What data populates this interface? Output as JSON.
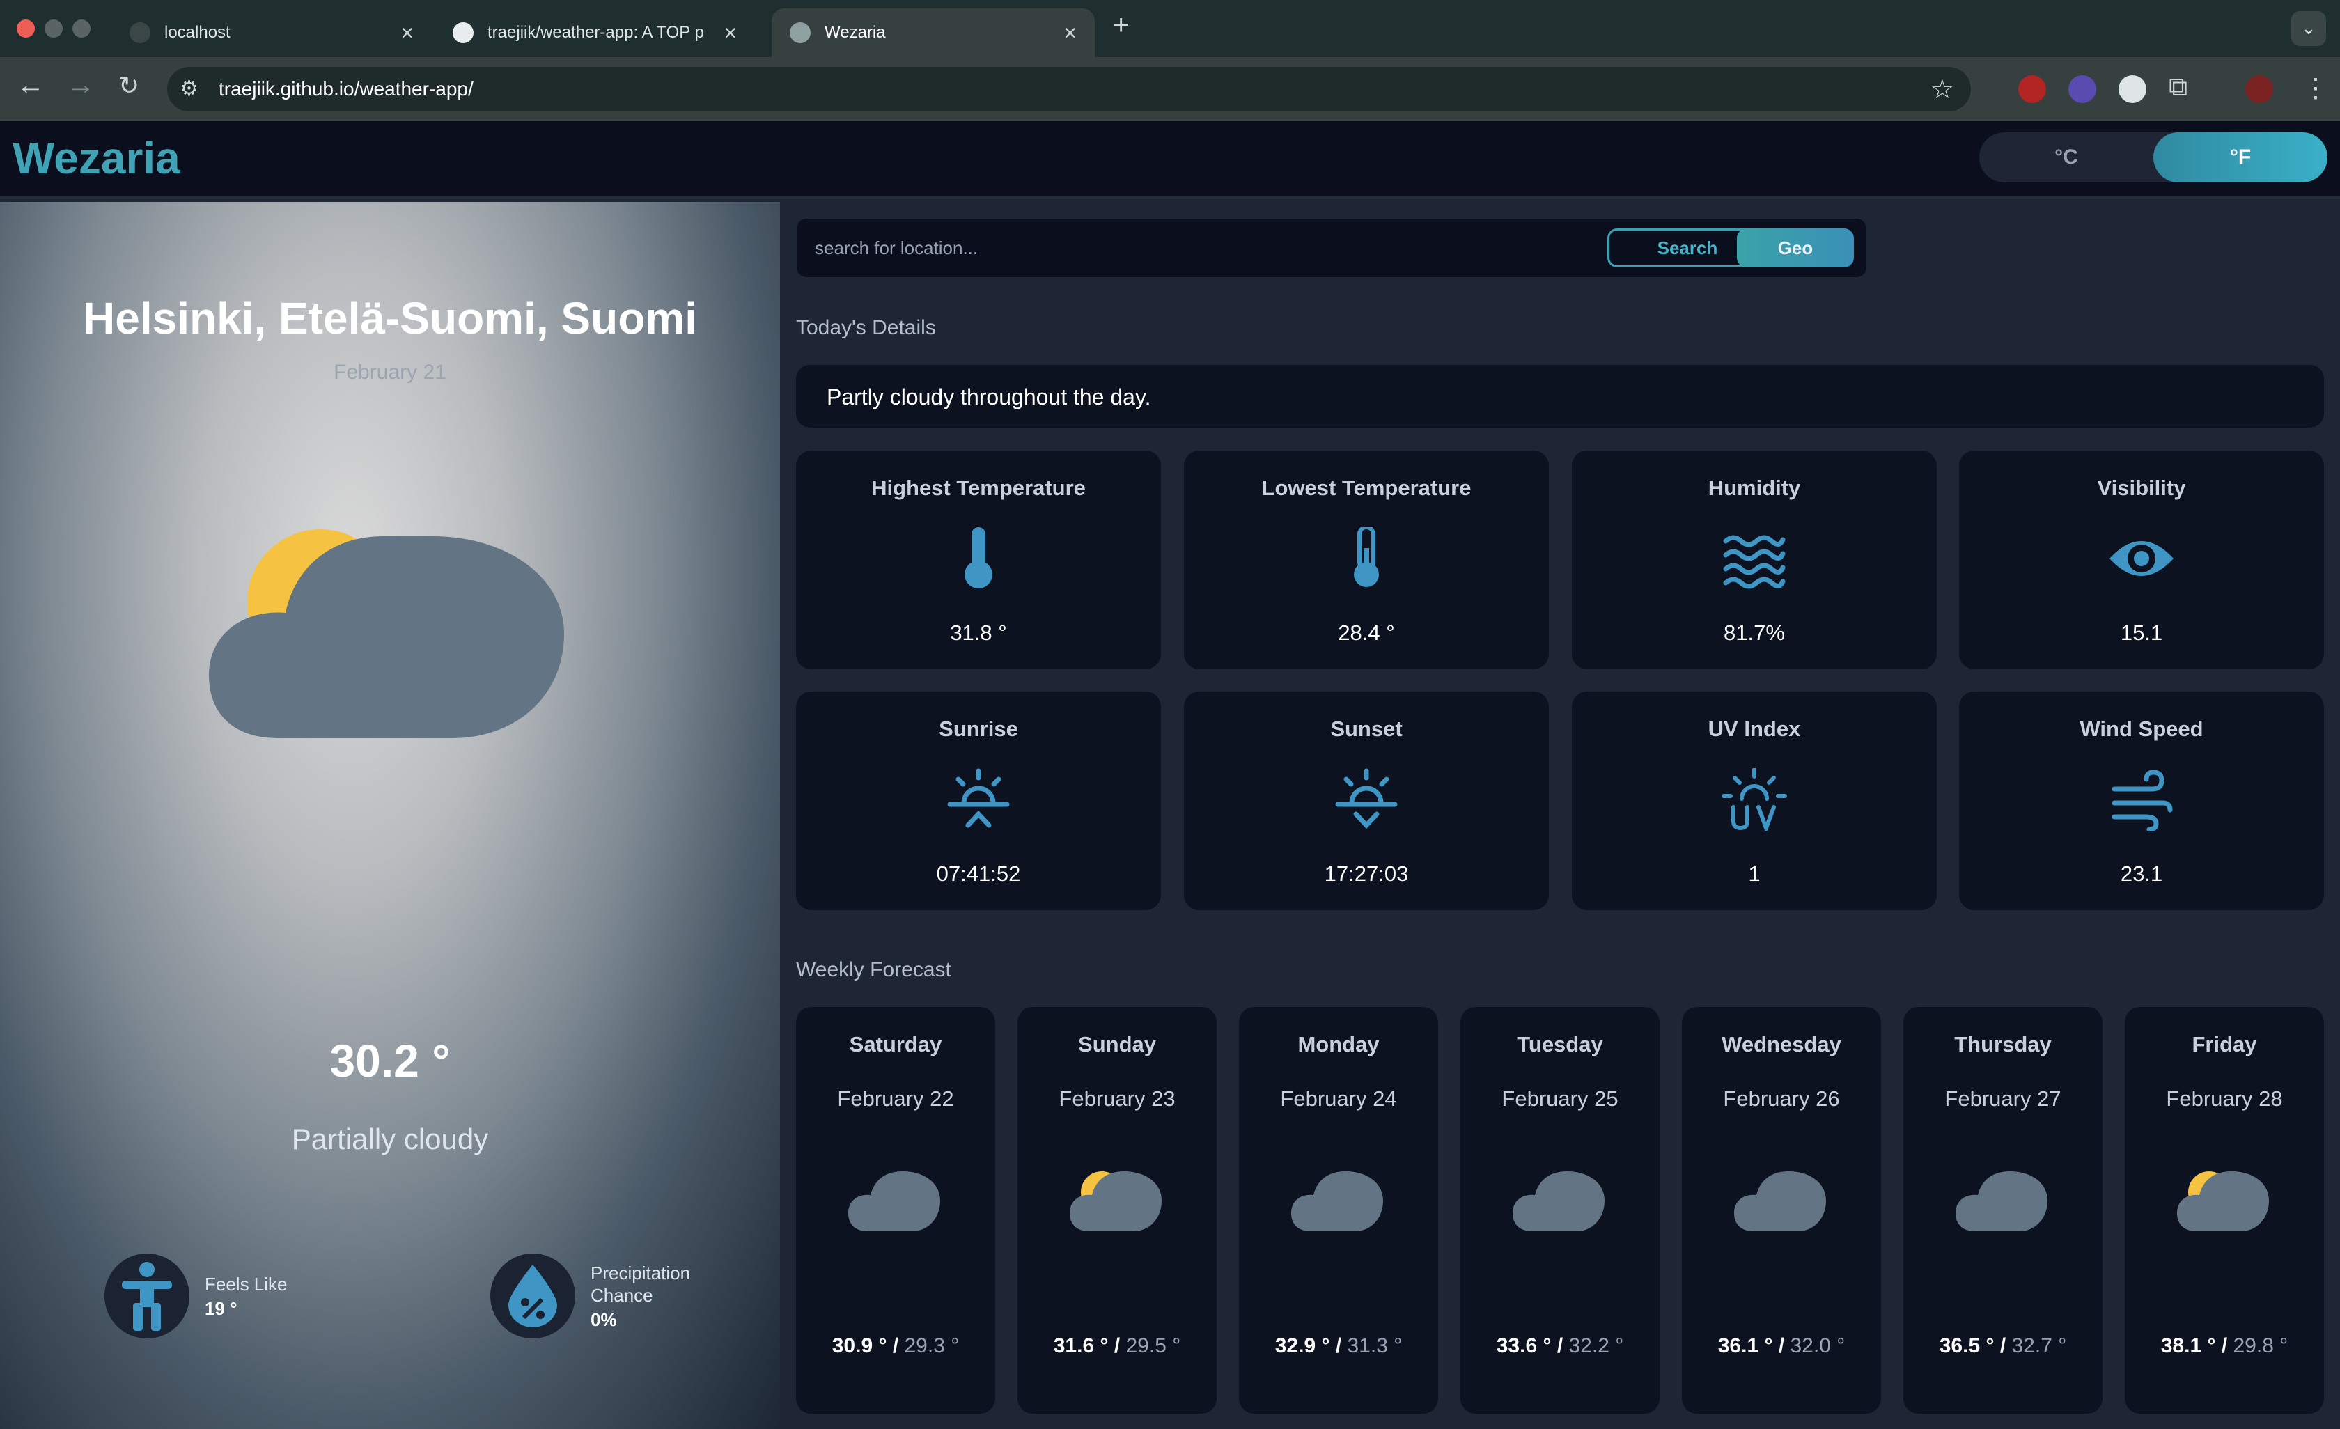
{
  "browser": {
    "tabs": [
      {
        "title": "localhost"
      },
      {
        "title": "traejiik/weather-app: A TOP p"
      },
      {
        "title": "Wezaria"
      }
    ],
    "url": "traejiik.github.io/weather-app/"
  },
  "app": {
    "logo": "Wezaria",
    "units": {
      "c": "°C",
      "f": "°F",
      "active": "f"
    }
  },
  "current": {
    "location": "Helsinki, Etelä-Suomi, Suomi",
    "date": "February 21",
    "temperature": "30.2 °",
    "condition": "Partially cloudy",
    "feels_like_label": "Feels Like",
    "feels_like_value": "19 °",
    "precip_label_1": "Precipitation",
    "precip_label_2": "Chance",
    "precip_value": "0%",
    "icon": "partly-cloudy-day-icon"
  },
  "search": {
    "placeholder": "search for location...",
    "search_label": "Search",
    "geo_label": "Geo"
  },
  "today": {
    "title": "Today's Details",
    "summary": "Partly cloudy throughout the day.",
    "cards": [
      {
        "title": "Highest Temperature",
        "value": "31.8 °",
        "icon": "thermometer-icon"
      },
      {
        "title": "Lowest Temperature",
        "value": "28.4 °",
        "icon": "thermometer-icon"
      },
      {
        "title": "Humidity",
        "value": "81.7%",
        "icon": "humidity-waves-icon"
      },
      {
        "title": "Visibility",
        "value": "15.1",
        "icon": "eye-icon"
      },
      {
        "title": "Sunrise",
        "value": "07:41:52",
        "icon": "sunrise-icon"
      },
      {
        "title": "Sunset",
        "value": "17:27:03",
        "icon": "sunset-icon"
      },
      {
        "title": "UV Index",
        "value": "1",
        "icon": "uv-index-icon"
      },
      {
        "title": "Wind Speed",
        "value": "23.1",
        "icon": "wind-icon"
      }
    ]
  },
  "weekly": {
    "title": "Weekly Forecast",
    "days": [
      {
        "day": "Saturday",
        "date": "February 22",
        "high": "30.9 °",
        "low": "29.3 °",
        "icon": "cloudy-icon"
      },
      {
        "day": "Sunday",
        "date": "February 23",
        "high": "31.6 °",
        "low": "29.5 °",
        "icon": "partly-cloudy-icon"
      },
      {
        "day": "Monday",
        "date": "February 24",
        "high": "32.9 °",
        "low": "31.3 °",
        "icon": "cloudy-icon"
      },
      {
        "day": "Tuesday",
        "date": "February 25",
        "high": "33.6 °",
        "low": "32.2 °",
        "icon": "cloudy-icon"
      },
      {
        "day": "Wednesday",
        "date": "February 26",
        "high": "36.1 °",
        "low": "32.0 °",
        "icon": "cloudy-icon"
      },
      {
        "day": "Thursday",
        "date": "February 27",
        "high": "36.5 °",
        "low": "32.7 °",
        "icon": "cloudy-icon"
      },
      {
        "day": "Friday",
        "date": "February 28",
        "high": "38.1 °",
        "low": "29.8 °",
        "icon": "partly-cloudy-icon"
      }
    ]
  },
  "colors": {
    "accent": "#3fa2b5",
    "panel": "#0d1221",
    "background": "#1e2535",
    "cloud": "#637585",
    "sun": "#f5c242"
  }
}
